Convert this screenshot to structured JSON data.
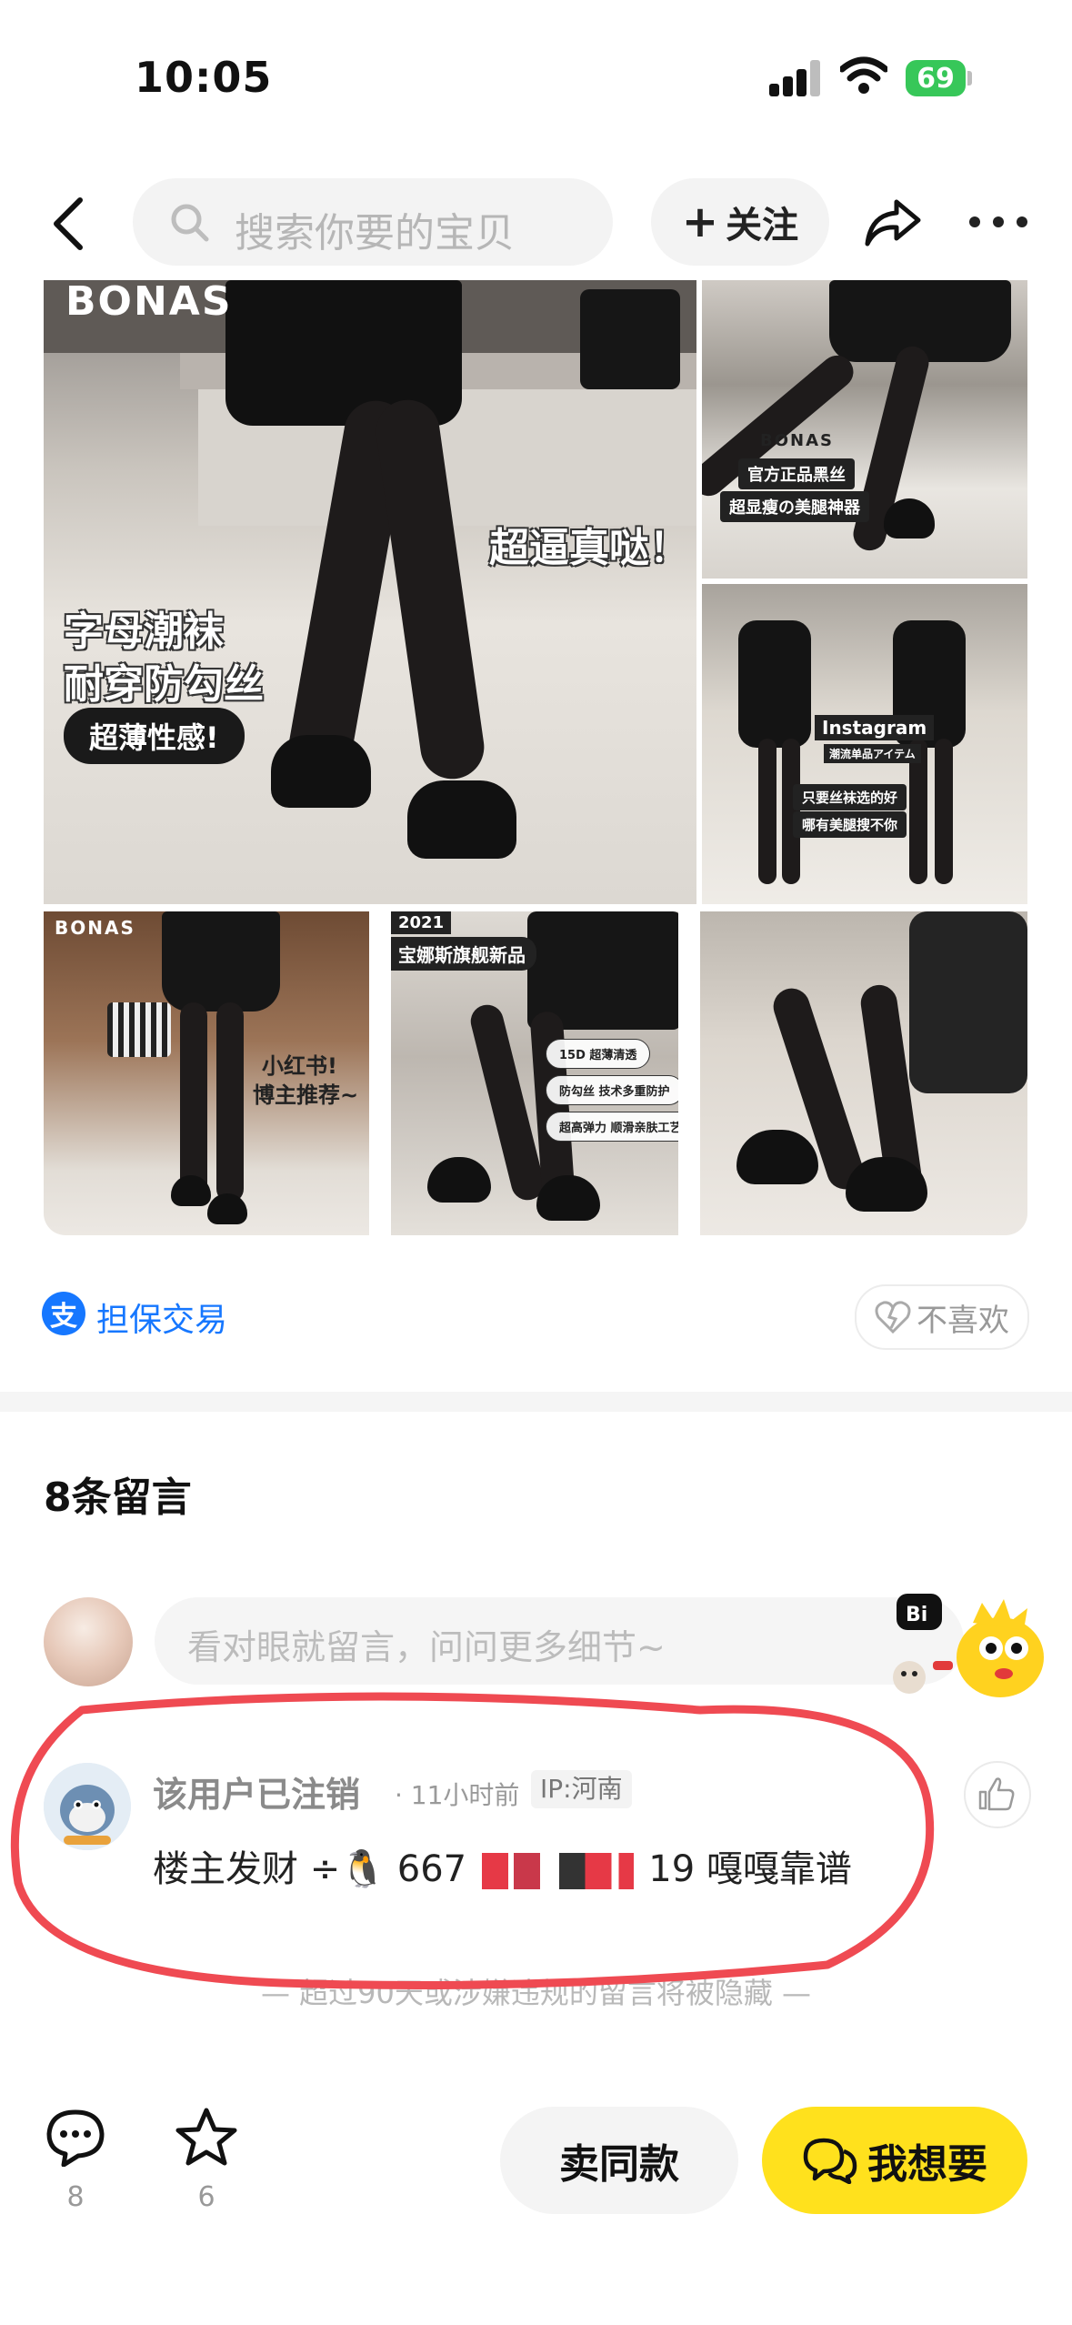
{
  "status_bar": {
    "time": "10:05",
    "battery": "69"
  },
  "header": {
    "search_placeholder": "搜索你要的宝贝",
    "follow_label": "关注"
  },
  "photos": {
    "main": {
      "brand": "BONAS",
      "slogan": "超逼真哒！",
      "headline_1": "字母潮袜",
      "headline_2": "耐穿防勾丝",
      "badge": "超薄性感!"
    },
    "top_right": {
      "brand": "BONAS",
      "line_1": "官方正品黑丝",
      "line_2": "超显瘦の美腿神器"
    },
    "mid_right": {
      "tag": "Instagram",
      "sub": "潮流单品アイテム",
      "line_1": "只要丝袜选的好",
      "line_2": "哪有美腿搜不你"
    },
    "bottom_left": {
      "brand": "BONAS",
      "text_1": "小红书!",
      "text_2": "博主推荐~"
    },
    "bottom_middle": {
      "year": "2021",
      "banner": "宝娜斯旗舰新品",
      "tag_1": "15D 超薄清透",
      "tag_2": "防勾丝 技术多重防护",
      "tag_3": "超高弹力 顺滑亲肤工艺"
    }
  },
  "trade": {
    "guarantee_icon": "支",
    "guarantee_label": "担保交易",
    "dislike_label": "不喜欢"
  },
  "comments": {
    "count_label": "8条留言",
    "input_placeholder": "看对眼就留言，问问更多细节~",
    "mascot_bubble": "Bi",
    "items": [
      {
        "user": "该用户已注销",
        "time": "· 11小时前",
        "ip": "IP:河南",
        "text_start": "楼主发财 ÷🐧 667",
        "text_end": "19 嘎嘎靠谱"
      }
    ],
    "notice": "— 超过90天或涉嫌违规的留言将被隐藏 —"
  },
  "bottom_bar": {
    "comment_count": "8",
    "favorite_count": "6",
    "sell_label": "卖同款",
    "want_label": "我想要"
  },
  "colors": {
    "accent_yellow": "#ffe11d",
    "alipay_blue": "#1677ff",
    "annotation_red": "#ef4a52"
  }
}
